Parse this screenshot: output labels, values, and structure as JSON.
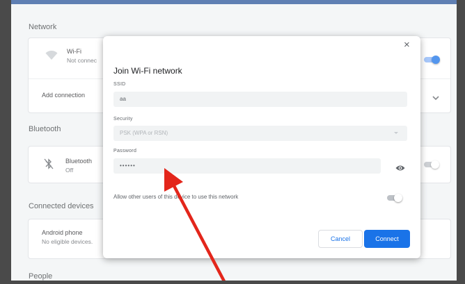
{
  "network": {
    "section_title": "Network",
    "wifi": {
      "title": "Wi-Fi",
      "status": "Not connec"
    },
    "add_connection": "Add connection"
  },
  "bluetooth": {
    "section_title": "Bluetooth",
    "title": "Bluetooth",
    "status": "Off"
  },
  "connected_devices": {
    "section_title": "Connected devices",
    "android_phone": {
      "title": "Android phone",
      "status": "No eligible devices."
    }
  },
  "people": {
    "section_title": "People"
  },
  "dialog": {
    "title": "Join Wi-Fi network",
    "ssid_label": "SSID",
    "ssid_value": "aa",
    "security_label": "Security",
    "security_value": "PSK (WPA or RSN)",
    "password_label": "Password",
    "password_value": "••••••",
    "allow_label": "Allow other users of this device to use this network",
    "cancel_label": "Cancel",
    "connect_label": "Connect",
    "close_glyph": "×"
  },
  "colors": {
    "accent": "#1a73e8",
    "annotation_arrow": "#e3261b"
  },
  "icons": [
    "wifi-icon",
    "bluetooth-off-icon",
    "chevron-down-icon",
    "close-icon",
    "eye-icon",
    "dropdown-caret-icon"
  ]
}
